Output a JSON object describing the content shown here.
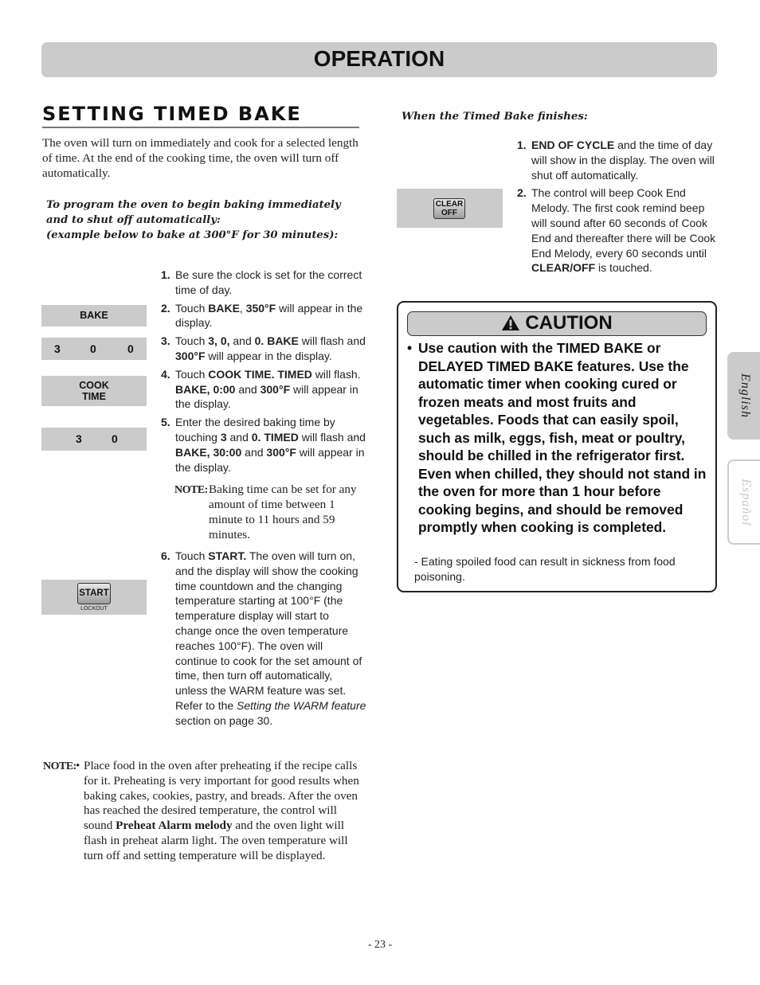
{
  "header": {
    "title": "OPERATION"
  },
  "section": {
    "title": "SETTING TIMED BAKE",
    "intro": "The oven will turn on immediately and cook for a selected length of time. At the end of the cooking time, the oven will turn off automatically.",
    "program_heading": [
      "To program the oven to begin baking immediately",
      "and to shut off automatically:",
      "(example below to bake at 300°F for 30 minutes):"
    ]
  },
  "keys": {
    "bake": "BAKE",
    "digits_300": [
      "3",
      "0",
      "0"
    ],
    "cook_time": [
      "COOK",
      "TIME"
    ],
    "digits_30": [
      "3",
      "0"
    ],
    "start": "START",
    "lockout": "LOCKOUT",
    "clear_off": [
      "CLEAR",
      "OFF"
    ]
  },
  "steps": [
    {
      "num": "1.",
      "parts": [
        [
          "t",
          "Be sure the clock is set for the correct time of day."
        ]
      ]
    },
    {
      "num": "2.",
      "parts": [
        [
          "t",
          "Touch "
        ],
        [
          "b",
          "BAKE"
        ],
        [
          "t",
          ", "
        ],
        [
          "b",
          "350°F"
        ],
        [
          "t",
          " will appear in the display."
        ]
      ]
    },
    {
      "num": "3.",
      "parts": [
        [
          "t",
          "Touch "
        ],
        [
          "b",
          "3, 0,"
        ],
        [
          "t",
          " and "
        ],
        [
          "b",
          "0. BAKE"
        ],
        [
          "t",
          " will flash and "
        ],
        [
          "b",
          "300°F"
        ],
        [
          "t",
          " will appear in the display."
        ]
      ]
    },
    {
      "num": "4.",
      "parts": [
        [
          "t",
          "Touch "
        ],
        [
          "b",
          "COOK TIME. TIMED"
        ],
        [
          "t",
          " will flash. "
        ],
        [
          "b",
          "BAKE, 0:00"
        ],
        [
          "t",
          " and "
        ],
        [
          "b",
          "300°F"
        ],
        [
          "t",
          " will appear in the display."
        ]
      ]
    },
    {
      "num": "5.",
      "parts": [
        [
          "t",
          "Enter the desired baking time by touching "
        ],
        [
          "b",
          "3"
        ],
        [
          "t",
          " and "
        ],
        [
          "b",
          "0. TIMED"
        ],
        [
          "t",
          " will flash and "
        ],
        [
          "b",
          "BAKE, 30:00"
        ],
        [
          "t",
          " and "
        ],
        [
          "b",
          "300°F"
        ],
        [
          "t",
          " will appear in the display."
        ]
      ]
    }
  ],
  "step6": {
    "num": "6.",
    "parts": [
      [
        "t",
        "Touch "
      ],
      [
        "b",
        "START."
      ],
      [
        "t",
        " The oven will turn on, and the display will show the cooking time countdown and the changing temperature starting at 100°F (the temperature display will start to change once the oven temperature reaches 100°F). The oven will continue to cook for the set amount of time, then turn off automatically, unless the WARM feature was set. Refer to the "
      ],
      [
        "i",
        "Setting the WARM feature"
      ],
      [
        "t",
        " section on page 30."
      ]
    ]
  },
  "note_label": "NOTE:",
  "note_inline": "Baking time can be set for any amount of time between 1 minute to 11 hours and 59 minutes.",
  "bottom_note": {
    "bullet": "•",
    "parts": [
      [
        "t",
        "Place food in the oven after preheating if the recipe calls for it. Preheating is very important for good results when baking cakes, cookies, pastry, and breads. After the oven has reached the desired temperature, the control will sound "
      ],
      [
        "b",
        "Preheat Alarm melody"
      ],
      [
        "t",
        " and the oven light will flash in preheat alarm light. The oven temperature will turn off and setting temperature will be displayed."
      ]
    ]
  },
  "finish": {
    "heading": "When the Timed Bake finishes:",
    "steps": [
      {
        "num": "1.",
        "parts": [
          [
            "b",
            "END OF CYCLE"
          ],
          [
            "t",
            " and the time of day will show in the display. The oven will shut off automatically."
          ]
        ]
      },
      {
        "num": "2.",
        "parts": [
          [
            "t",
            "The control will beep Cook End Melody. The first cook remind beep will sound after 60 seconds of Cook End and thereafter there will be Cook End Melody, every 60 seconds until "
          ],
          [
            "b",
            "CLEAR/OFF"
          ],
          [
            "t",
            " is touched."
          ]
        ]
      }
    ]
  },
  "caution": {
    "title": "CAUTION",
    "icon": "warning-triangle-icon",
    "bullet": "•",
    "text": "Use caution with the TIMED BAKE or DELAYED TIMED BAKE features. Use the automatic timer when cooking cured or frozen meats and most fruits and vegetables. Foods that can easily spoil, such as milk, eggs, fish, meat or poultry, should be chilled in the refrigerator first. Even when chilled, they should not stand in the oven for more than 1 hour before cooking begins, and should be removed promptly when cooking is completed.",
    "sub": "- Eating spoiled food can result in sickness from food poisoning."
  },
  "side_tabs": [
    {
      "label": "English",
      "active": true
    },
    {
      "label": "Español",
      "active": false
    }
  ],
  "page_number": "- 23 -"
}
